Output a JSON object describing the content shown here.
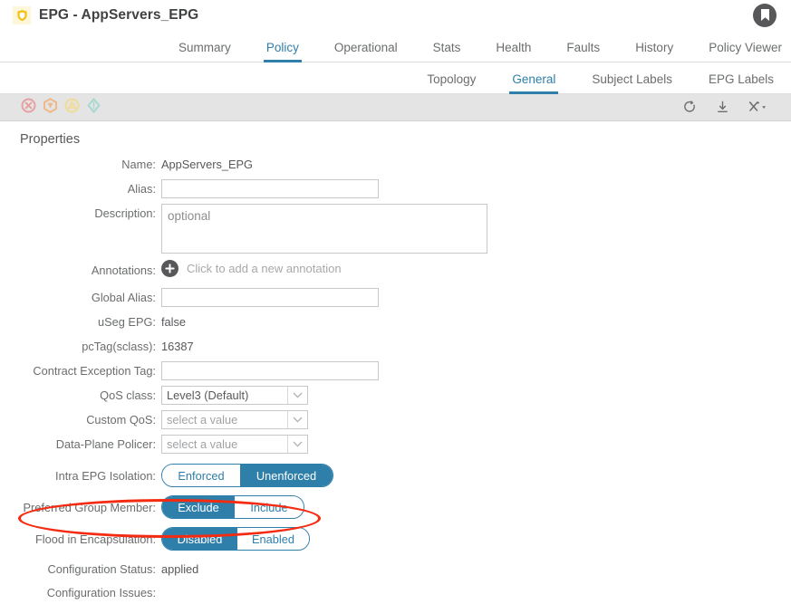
{
  "window": {
    "title": "EPG - AppServers_EPG",
    "shield_icon": "shield-icon",
    "avatar_icon": "bookmark-avatar-icon"
  },
  "tabs": [
    {
      "label": "Summary",
      "active": false
    },
    {
      "label": "Policy",
      "active": true
    },
    {
      "label": "Operational",
      "active": false
    },
    {
      "label": "Stats",
      "active": false
    },
    {
      "label": "Health",
      "active": false
    },
    {
      "label": "Faults",
      "active": false
    },
    {
      "label": "History",
      "active": false
    },
    {
      "label": "Policy Viewer",
      "active": false
    }
  ],
  "subtabs": [
    {
      "label": "Topology",
      "active": false
    },
    {
      "label": "General",
      "active": true
    },
    {
      "label": "Subject Labels",
      "active": false
    },
    {
      "label": "EPG Labels",
      "active": false
    }
  ],
  "toolbar": {
    "fault_icons": [
      {
        "name": "fault-critical-icon",
        "color": "#e8a0a0"
      },
      {
        "name": "fault-major-icon",
        "color": "#f0b98a"
      },
      {
        "name": "fault-minor-icon",
        "color": "#f0dc96"
      },
      {
        "name": "fault-warning-icon",
        "color": "#a8d8d0"
      }
    ],
    "refresh_icon": "refresh-icon",
    "download_icon": "download-icon",
    "tools_icon": "tools-icon"
  },
  "properties": {
    "section_title": "Properties",
    "name_label": "Name:",
    "name_value": "AppServers_EPG",
    "alias_label": "Alias:",
    "alias_value": "",
    "description_label": "Description:",
    "description_placeholder": "optional",
    "description_value": "",
    "annotations_label": "Annotations:",
    "annotations_hint": "Click to add a new annotation",
    "global_alias_label": "Global Alias:",
    "global_alias_value": "",
    "useg_label": "uSeg EPG:",
    "useg_value": "false",
    "pctag_label": "pcTag(sclass):",
    "pctag_value": "16387",
    "contract_exception_label": "Contract Exception Tag:",
    "contract_exception_value": "",
    "qos_label": "QoS class:",
    "qos_value": "Level3 (Default)",
    "custom_qos_label": "Custom QoS:",
    "custom_qos_placeholder": "select a value",
    "policer_label": "Data-Plane Policer:",
    "policer_placeholder": "select a value",
    "intra_epg_label": "Intra EPG Isolation:",
    "intra_epg_options": [
      {
        "label": "Enforced",
        "selected": false
      },
      {
        "label": "Unenforced",
        "selected": true
      }
    ],
    "preferred_group_label": "Preferred Group Member:",
    "preferred_group_options": [
      {
        "label": "Exclude",
        "selected": true
      },
      {
        "label": "Include",
        "selected": false
      }
    ],
    "flood_label": "Flood in Encapsulation:",
    "flood_options": [
      {
        "label": "Disabled",
        "selected": true
      },
      {
        "label": "Enabled",
        "selected": false
      }
    ],
    "config_status_label": "Configuration Status:",
    "config_status_value": "applied",
    "config_issues_label": "Configuration Issues:"
  },
  "colors": {
    "accent_blue": "#2f7fab",
    "annotation_red": "#f42b11",
    "toolbar_gray": "#e4e4e4"
  }
}
